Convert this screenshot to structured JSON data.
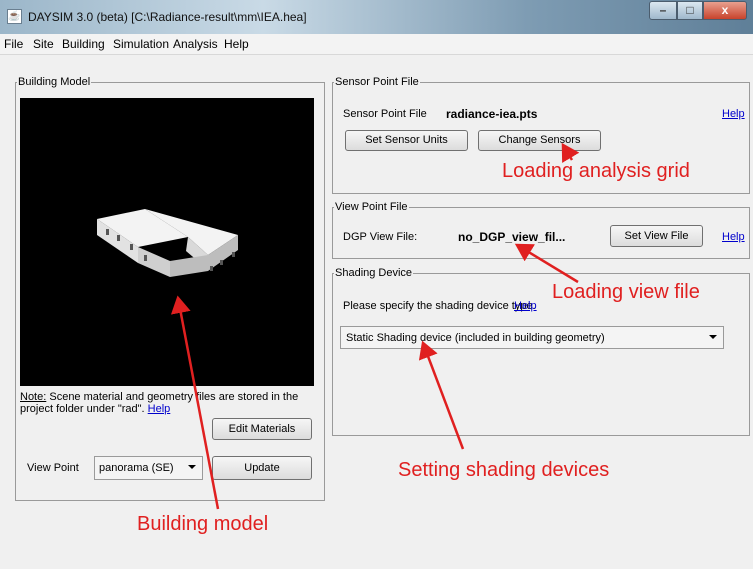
{
  "window": {
    "title": "DAYSIM 3.0 (beta) [C:\\Radiance-result\\mm\\IEA.hea]",
    "min": "–",
    "max": "□",
    "close": "x",
    "icon": "app-icon"
  },
  "menu": [
    "File",
    "Site",
    "Building",
    "Simulation",
    "Analysis",
    "Help"
  ],
  "building_model": {
    "legend": "Building Model",
    "note_label": "Note:",
    "note_text": "Scene material and geometry files are stored in the project folder under \"rad\".",
    "note_help": "Help",
    "edit_materials": "Edit Materials",
    "view_point_label": "View Point",
    "view_point_value": "panorama (SE)",
    "update": "Update"
  },
  "sensor": {
    "legend": "Sensor Point File",
    "label": "Sensor Point File",
    "value": "radiance-iea.pts",
    "help": "Help",
    "set_units": "Set Sensor Units",
    "change": "Change Sensors"
  },
  "view": {
    "legend": "View Point File",
    "label": "DGP View File:",
    "value": "no_DGP_view_fil...",
    "set_button": "Set View File",
    "help": "Help"
  },
  "shading": {
    "legend": "Shading Device",
    "prompt": "Please specify the shading device type.",
    "help": "Help",
    "selected": "Static Shading device (included in building geometry)"
  },
  "annotations": {
    "grid": "Loading analysis grid",
    "view": "Loading view file",
    "shading": "Setting shading devices",
    "model": "Building model",
    "color": "#e02020"
  }
}
